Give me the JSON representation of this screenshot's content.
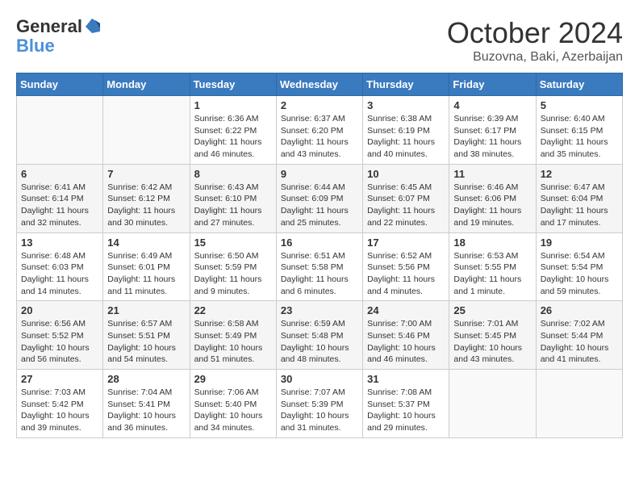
{
  "header": {
    "logo_general": "General",
    "logo_blue": "Blue",
    "month": "October 2024",
    "location": "Buzovna, Baki, Azerbaijan"
  },
  "weekdays": [
    "Sunday",
    "Monday",
    "Tuesday",
    "Wednesday",
    "Thursday",
    "Friday",
    "Saturday"
  ],
  "weeks": [
    [
      {
        "day": "",
        "info": ""
      },
      {
        "day": "",
        "info": ""
      },
      {
        "day": "1",
        "info": "Sunrise: 6:36 AM\nSunset: 6:22 PM\nDaylight: 11 hours and 46 minutes."
      },
      {
        "day": "2",
        "info": "Sunrise: 6:37 AM\nSunset: 6:20 PM\nDaylight: 11 hours and 43 minutes."
      },
      {
        "day": "3",
        "info": "Sunrise: 6:38 AM\nSunset: 6:19 PM\nDaylight: 11 hours and 40 minutes."
      },
      {
        "day": "4",
        "info": "Sunrise: 6:39 AM\nSunset: 6:17 PM\nDaylight: 11 hours and 38 minutes."
      },
      {
        "day": "5",
        "info": "Sunrise: 6:40 AM\nSunset: 6:15 PM\nDaylight: 11 hours and 35 minutes."
      }
    ],
    [
      {
        "day": "6",
        "info": "Sunrise: 6:41 AM\nSunset: 6:14 PM\nDaylight: 11 hours and 32 minutes."
      },
      {
        "day": "7",
        "info": "Sunrise: 6:42 AM\nSunset: 6:12 PM\nDaylight: 11 hours and 30 minutes."
      },
      {
        "day": "8",
        "info": "Sunrise: 6:43 AM\nSunset: 6:10 PM\nDaylight: 11 hours and 27 minutes."
      },
      {
        "day": "9",
        "info": "Sunrise: 6:44 AM\nSunset: 6:09 PM\nDaylight: 11 hours and 25 minutes."
      },
      {
        "day": "10",
        "info": "Sunrise: 6:45 AM\nSunset: 6:07 PM\nDaylight: 11 hours and 22 minutes."
      },
      {
        "day": "11",
        "info": "Sunrise: 6:46 AM\nSunset: 6:06 PM\nDaylight: 11 hours and 19 minutes."
      },
      {
        "day": "12",
        "info": "Sunrise: 6:47 AM\nSunset: 6:04 PM\nDaylight: 11 hours and 17 minutes."
      }
    ],
    [
      {
        "day": "13",
        "info": "Sunrise: 6:48 AM\nSunset: 6:03 PM\nDaylight: 11 hours and 14 minutes."
      },
      {
        "day": "14",
        "info": "Sunrise: 6:49 AM\nSunset: 6:01 PM\nDaylight: 11 hours and 11 minutes."
      },
      {
        "day": "15",
        "info": "Sunrise: 6:50 AM\nSunset: 5:59 PM\nDaylight: 11 hours and 9 minutes."
      },
      {
        "day": "16",
        "info": "Sunrise: 6:51 AM\nSunset: 5:58 PM\nDaylight: 11 hours and 6 minutes."
      },
      {
        "day": "17",
        "info": "Sunrise: 6:52 AM\nSunset: 5:56 PM\nDaylight: 11 hours and 4 minutes."
      },
      {
        "day": "18",
        "info": "Sunrise: 6:53 AM\nSunset: 5:55 PM\nDaylight: 11 hours and 1 minute."
      },
      {
        "day": "19",
        "info": "Sunrise: 6:54 AM\nSunset: 5:54 PM\nDaylight: 10 hours and 59 minutes."
      }
    ],
    [
      {
        "day": "20",
        "info": "Sunrise: 6:56 AM\nSunset: 5:52 PM\nDaylight: 10 hours and 56 minutes."
      },
      {
        "day": "21",
        "info": "Sunrise: 6:57 AM\nSunset: 5:51 PM\nDaylight: 10 hours and 54 minutes."
      },
      {
        "day": "22",
        "info": "Sunrise: 6:58 AM\nSunset: 5:49 PM\nDaylight: 10 hours and 51 minutes."
      },
      {
        "day": "23",
        "info": "Sunrise: 6:59 AM\nSunset: 5:48 PM\nDaylight: 10 hours and 48 minutes."
      },
      {
        "day": "24",
        "info": "Sunrise: 7:00 AM\nSunset: 5:46 PM\nDaylight: 10 hours and 46 minutes."
      },
      {
        "day": "25",
        "info": "Sunrise: 7:01 AM\nSunset: 5:45 PM\nDaylight: 10 hours and 43 minutes."
      },
      {
        "day": "26",
        "info": "Sunrise: 7:02 AM\nSunset: 5:44 PM\nDaylight: 10 hours and 41 minutes."
      }
    ],
    [
      {
        "day": "27",
        "info": "Sunrise: 7:03 AM\nSunset: 5:42 PM\nDaylight: 10 hours and 39 minutes."
      },
      {
        "day": "28",
        "info": "Sunrise: 7:04 AM\nSunset: 5:41 PM\nDaylight: 10 hours and 36 minutes."
      },
      {
        "day": "29",
        "info": "Sunrise: 7:06 AM\nSunset: 5:40 PM\nDaylight: 10 hours and 34 minutes."
      },
      {
        "day": "30",
        "info": "Sunrise: 7:07 AM\nSunset: 5:39 PM\nDaylight: 10 hours and 31 minutes."
      },
      {
        "day": "31",
        "info": "Sunrise: 7:08 AM\nSunset: 5:37 PM\nDaylight: 10 hours and 29 minutes."
      },
      {
        "day": "",
        "info": ""
      },
      {
        "day": "",
        "info": ""
      }
    ]
  ]
}
